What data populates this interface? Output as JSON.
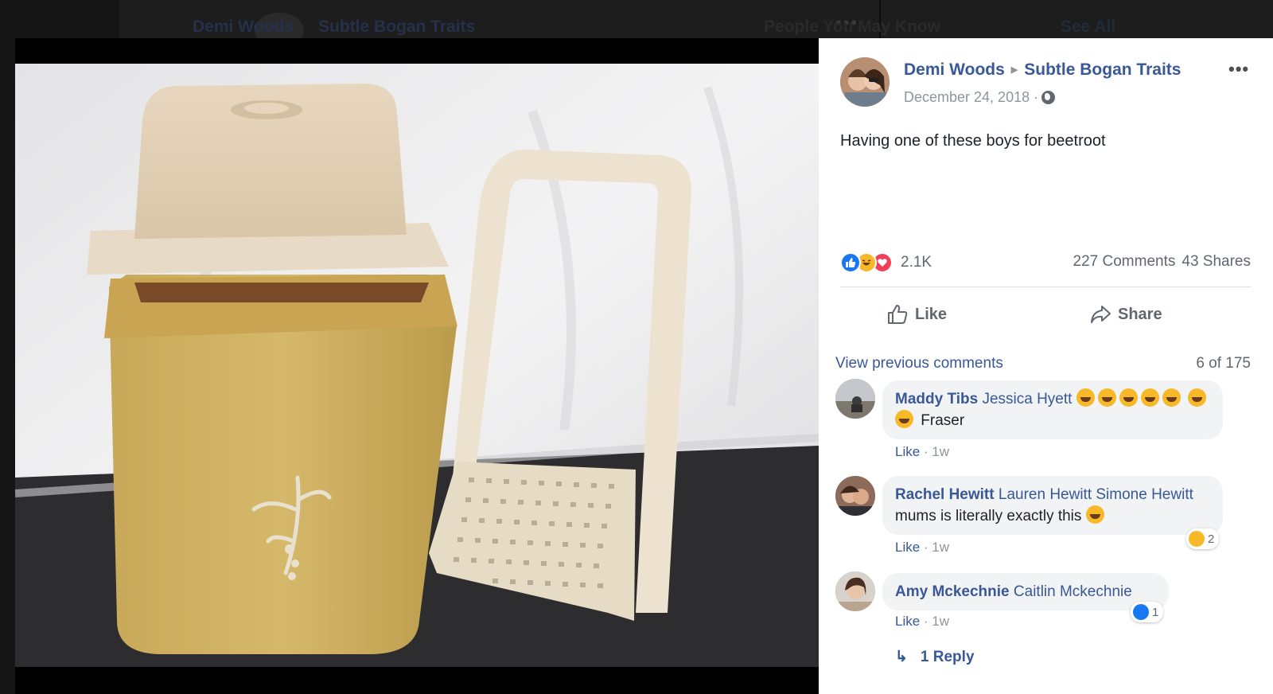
{
  "background": {
    "author": "Demi Woods",
    "group": "Subtle Bogan Traits",
    "people_you_may_know": "People You May Know",
    "see_all": "See All"
  },
  "post": {
    "author": "Demi Woods",
    "group": "Subtle Bogan Traits",
    "date": "December 24, 2018 ·",
    "text": "Having one of these boys for beetroot",
    "more_icon": "more-options-icon",
    "privacy_icon": "globe-icon"
  },
  "stats": {
    "reaction_icons": [
      "like-reaction-icon",
      "haha-reaction-icon",
      "love-reaction-icon"
    ],
    "reaction_count": "2.1K",
    "comments": "227 Comments",
    "shares": "43 Shares"
  },
  "actions": {
    "like": "Like",
    "share": "Share"
  },
  "comments_header": {
    "view_previous": "View previous comments",
    "count": "6 of 175"
  },
  "comments": [
    {
      "name": "Maddy Tibs",
      "tag": "Jessica Hyett",
      "text": "Fraser",
      "like": "Like",
      "time": " · 1w"
    },
    {
      "name": "Rachel Hewitt",
      "tag": "Lauren Hewitt Simone Hewitt",
      "text": "mums is literally exactly this",
      "like": "Like",
      "time": " · 1w",
      "reactions": "2"
    },
    {
      "name": "Amy Mckechnie",
      "tag": "Caitlin Mckechnie",
      "like": "Like",
      "time": " · 1w",
      "reactions": "1"
    }
  ],
  "reply": "1 Reply",
  "colors": {
    "link": "#385898",
    "like_blue": "#1877f2",
    "haha_yellow": "#f7b928",
    "love_red": "#f33e58",
    "bubble": "#f2f3f5"
  }
}
